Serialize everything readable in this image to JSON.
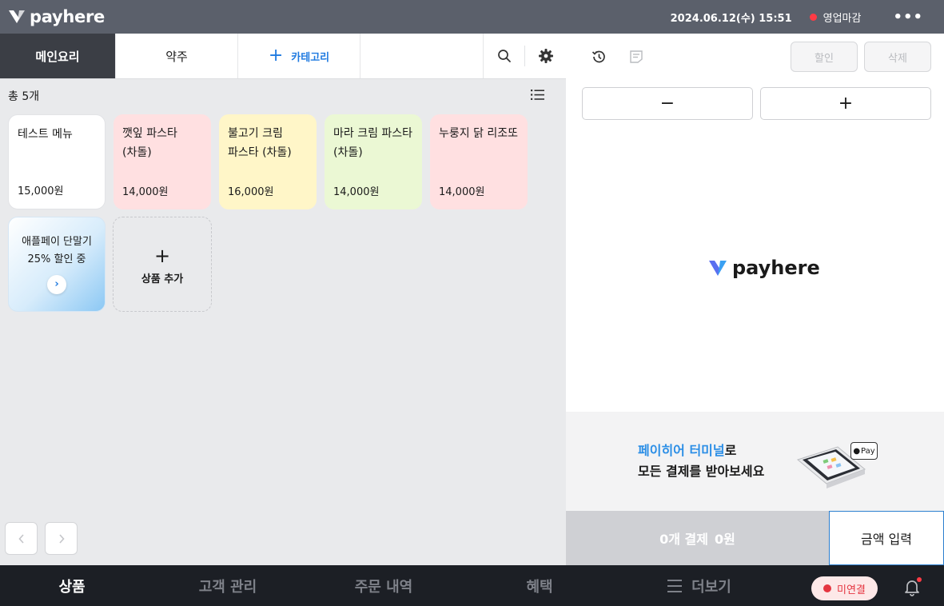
{
  "header": {
    "brand": "payhere",
    "datetime": "2024.06.12(수) 15:51",
    "status_label": "영업마감",
    "more_label": "•••"
  },
  "tabs": [
    {
      "label": "메인요리",
      "active": true
    },
    {
      "label": "약주",
      "active": false
    }
  ],
  "add_category_label": "카테고리",
  "toolbar_icons": [
    "search-icon",
    "gear-icon"
  ],
  "product_list": {
    "count_label": "총 5개",
    "items": [
      {
        "name": "테스트 메뉴",
        "price": "15,000원",
        "color": "#ffffff"
      },
      {
        "name": "깻잎 파스타(차돌)",
        "price": "14,000원",
        "color": "#ffe0e1"
      },
      {
        "name": "불고기 크림 파스타 (차돌)",
        "price": "16,000원",
        "color": "#fff6c8"
      },
      {
        "name": "마라 크림 파스타 (차돌)",
        "price": "14,000원",
        "color": "#ebf8d4"
      },
      {
        "name": "누룽지 닭 리조또",
        "price": "14,000원",
        "color": "#ffe0e1"
      }
    ],
    "promo": {
      "line1": "애플페이 단말기",
      "line2": "25% 할인 중"
    },
    "add_product_label": "상품 추가"
  },
  "order_panel": {
    "discount_label": "할인",
    "delete_label": "삭제",
    "minus_label": "−",
    "plus_label": "+",
    "brand": "payhere",
    "banner": {
      "highlight": "페이히어 터미널",
      "suffix": "로",
      "line2": "모든 결제를 받아보세요",
      "device_badge": "Pay"
    },
    "pay_count": "0개 결제",
    "pay_amount": "0원",
    "amount_input_label": "금액 입력"
  },
  "bottom_nav": {
    "items": [
      "상품",
      "고객 관리",
      "주문 내역",
      "혜택"
    ],
    "more_label": "더보기",
    "connection_label": "미연결"
  },
  "colors": {
    "accent": "#1f7ae0",
    "topbar": "#5b606b",
    "active_tab": "#3b3e45",
    "bottom_nav": "#1c1f25",
    "alert": "#e53540"
  }
}
